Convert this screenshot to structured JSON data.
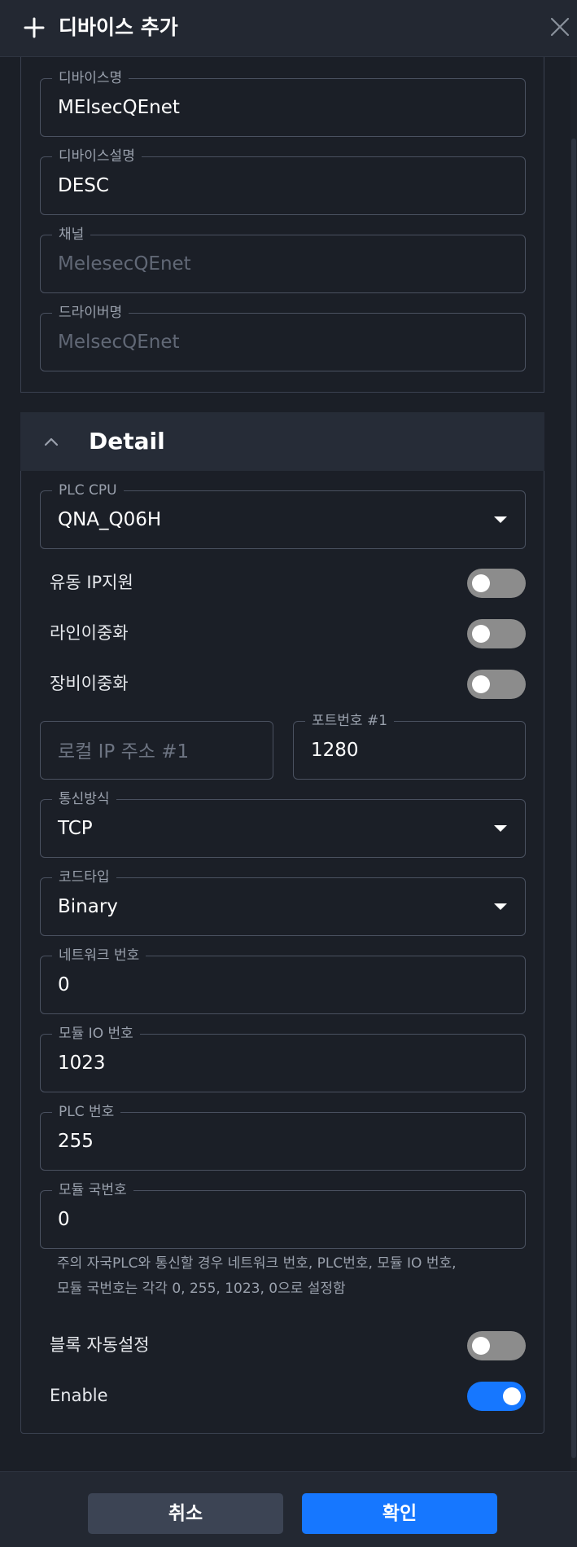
{
  "header": {
    "title": "디바이스 추가",
    "add_icon": "plus-icon",
    "close_icon": "close-icon"
  },
  "basic": {
    "device_name": {
      "label": "디바이스명",
      "value": "MElsecQEnet"
    },
    "device_desc": {
      "label": "디바이스설명",
      "value": "DESC"
    },
    "channel": {
      "label": "채널",
      "value": "MelesecQEnet"
    },
    "driver": {
      "label": "드라이버명",
      "value": "MelsecQEnet"
    }
  },
  "detail": {
    "title": "Detail",
    "plc_cpu": {
      "label": "PLC CPU",
      "value": "QNA_Q06H"
    },
    "toggles": [
      {
        "label": "유동 IP지원",
        "on": false
      },
      {
        "label": "라인이중화",
        "on": false
      },
      {
        "label": "장비이중화",
        "on": false
      }
    ],
    "local_ip": {
      "placeholder": "로컬 IP 주소 #1"
    },
    "port": {
      "label": "포트번호 #1",
      "value": "1280"
    },
    "comm_method": {
      "label": "통신방식",
      "value": "TCP"
    },
    "code_type": {
      "label": "코드타입",
      "value": "Binary"
    },
    "network_no": {
      "label": "네트워크 번호",
      "value": "0"
    },
    "module_io": {
      "label": "모듈 IO 번호",
      "value": "1023"
    },
    "plc_no": {
      "label": "PLC 번호",
      "value": "255"
    },
    "module_station": {
      "label": "모듈 국번호",
      "value": "0"
    },
    "note_line1": "주의 자국PLC와 통신할 경우 네트워크 번호, PLC번호, 모듈 IO 번호,",
    "note_line2": "모듈 국번호는 각각 0, 255, 1023, 0으로 설정함",
    "block_auto": {
      "label": "블록 자동설정",
      "on": false
    },
    "enable": {
      "label": "Enable",
      "on": true
    }
  },
  "footer": {
    "cancel_label": "취소",
    "confirm_label": "확인"
  },
  "colors": {
    "accent": "#1677ff",
    "toggle_off": "#8c8c8c",
    "background": "#1b1f27"
  }
}
